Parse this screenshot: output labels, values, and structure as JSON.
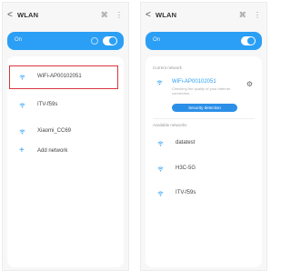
{
  "left_screen": {
    "back_glyph": "<",
    "title": "WLAN",
    "header_icons": [
      "⌘",
      "⋮"
    ],
    "toggle_label": "On",
    "toggle_on": true,
    "networks": [
      {
        "name": "WiFi-AP00102051",
        "highlighted": true
      },
      {
        "name": "ITV-f59s"
      },
      {
        "name": "Xiaomi_CC69"
      }
    ],
    "add_network_label": "Add network"
  },
  "right_screen": {
    "back_glyph": "<",
    "title": "WLAN",
    "header_icons": [
      "⌘",
      "⋮"
    ],
    "toggle_label": "On",
    "toggle_on": true,
    "current_section_label": "Current network",
    "current_network": {
      "name": "WiFi-AP00102051",
      "description": "Checking the quality of your Internet connection..."
    },
    "security_button_label": "Security detection",
    "available_section_label": "Available networks",
    "available_networks": [
      {
        "name": "datatest"
      },
      {
        "name": "H3C-5G"
      },
      {
        "name": "ITV-f59s"
      }
    ]
  },
  "colors": {
    "accent": "#2b9ff5",
    "highlight_border": "#d9363e",
    "screen_bg": "#f7f7f7",
    "card_bg": "#ffffff"
  },
  "icons": [
    "back-arrow-icon",
    "scan-icon",
    "more-icon",
    "wifi-icon",
    "plus-icon",
    "gear-icon",
    "toggle-icon"
  ]
}
